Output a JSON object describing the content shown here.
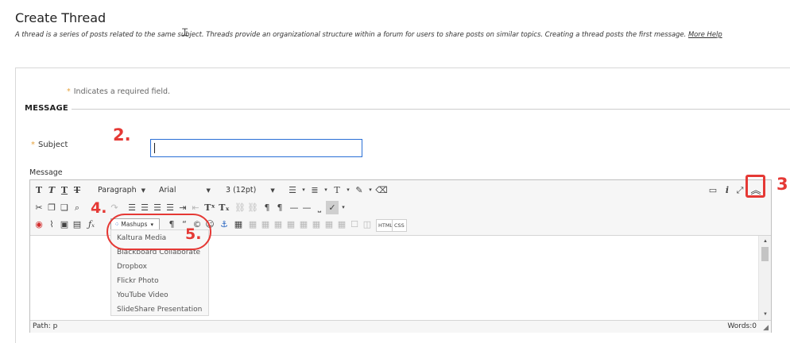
{
  "header": {
    "title": "Create Thread",
    "description": "A thread is a series of posts related to the same subject. Threads provide an organizational structure within a forum for users to share posts on similar topics. Creating a thread posts the first message.",
    "more_help": "More Help"
  },
  "form": {
    "required_note": "Indicates a required field.",
    "section_title": "MESSAGE",
    "subject_label": "Subject",
    "subject_value": "",
    "message_label": "Message"
  },
  "toolbar": {
    "row1": {
      "paragraph_select": "Paragraph",
      "font_select": "Arial",
      "size_select": "3 (12pt)"
    },
    "row3": {
      "mashups_label": "Mashups",
      "html_label": "HTML",
      "css_label": "CSS"
    }
  },
  "mashups_menu": {
    "items": [
      "Kaltura Media",
      "Blackboard Collaborate",
      "Dropbox",
      "Flickr Photo",
      "YouTube Video",
      "SlideShare Presentation"
    ]
  },
  "statusbar": {
    "path": "Path: p",
    "words": "Words:0"
  },
  "annotations": {
    "step2": "2.",
    "step3": "3",
    "step4": "4.",
    "step5": "5."
  },
  "colors": {
    "annotation_red": "#e53935",
    "input_focus_blue": "#2a6fd6",
    "required_star": "#e6a23c"
  }
}
